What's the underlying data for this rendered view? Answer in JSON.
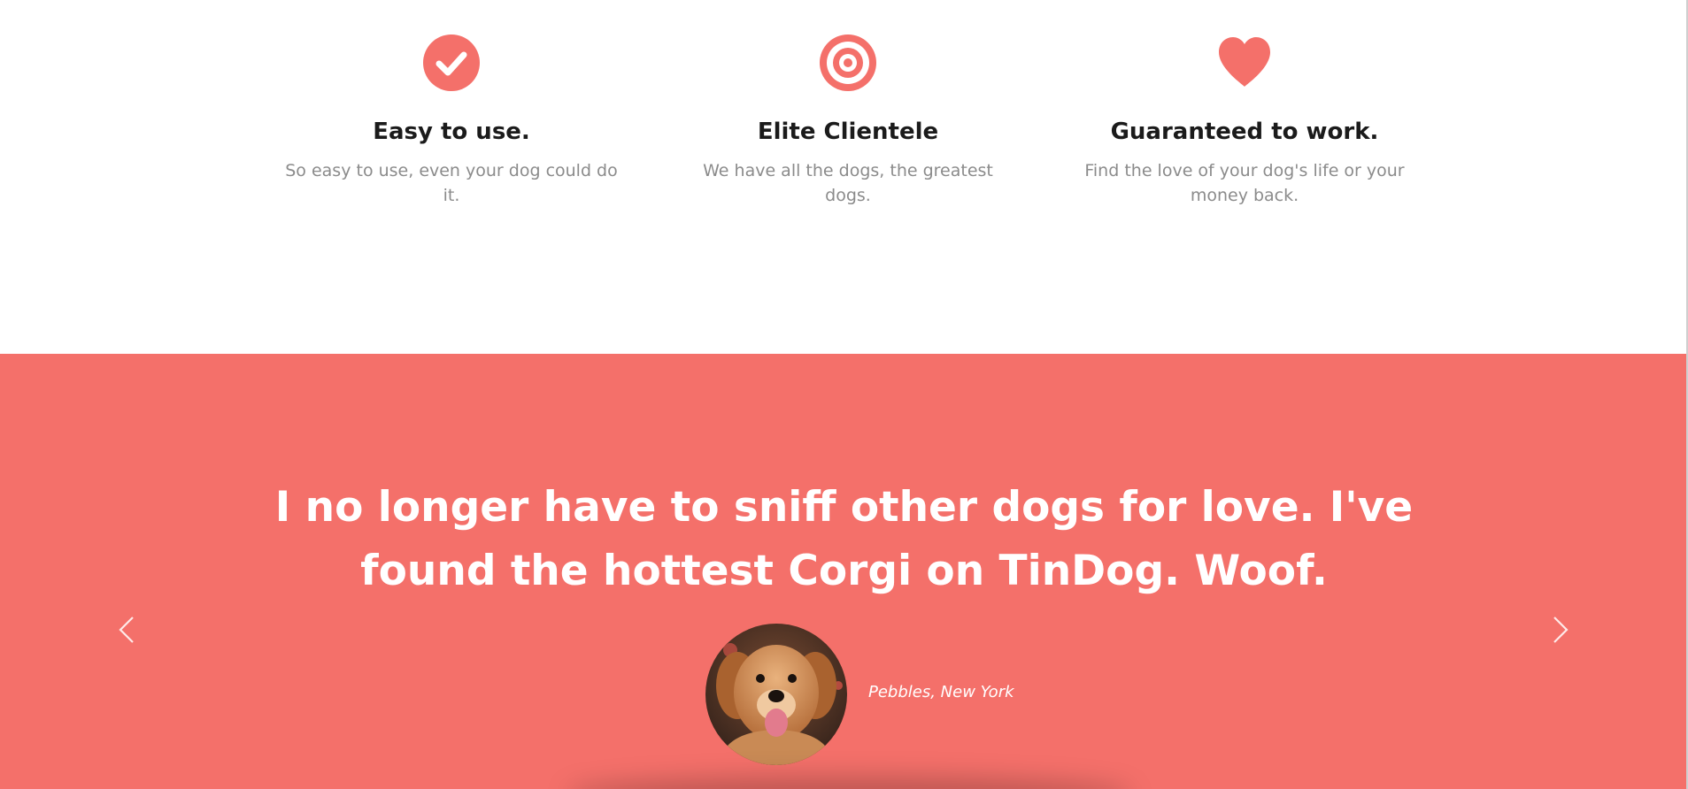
{
  "colors": {
    "accent": "#f4706a",
    "heading": "#1b1b1b",
    "muted": "#8b8b8b",
    "white": "#ffffff"
  },
  "features": [
    {
      "icon": "check-circle-icon",
      "title": "Easy to use.",
      "description": "So easy to use, even your dog could do it."
    },
    {
      "icon": "bullseye-icon",
      "title": "Elite Clientele",
      "description": "We have all the dogs, the greatest dogs."
    },
    {
      "icon": "heart-icon",
      "title": "Guaranteed to work.",
      "description": "Find the love of your dog's life or your money back."
    }
  ],
  "testimonial": {
    "quote": "I no longer have to sniff other dogs for love. I've found the hottest Corgi on TinDog. Woof.",
    "author": "Pebbles, New York",
    "prev_icon": "chevron-left-icon",
    "next_icon": "chevron-right-icon"
  }
}
